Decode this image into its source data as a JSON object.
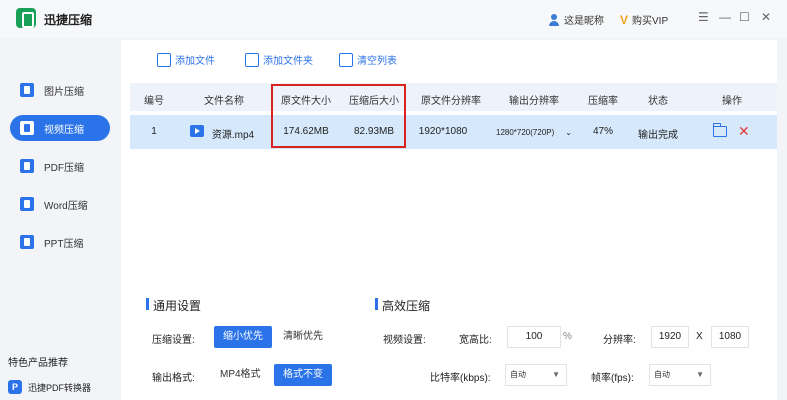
{
  "app": {
    "title": "迅捷压缩"
  },
  "account": {
    "user": "这是昵称",
    "vip": "购买VIP"
  },
  "window_controls": {
    "menu": "☰",
    "minimize": "—",
    "maximize": "☐",
    "close": "✕"
  },
  "sidebar": {
    "items": [
      {
        "label": "图片压缩",
        "icon": "image-icon"
      },
      {
        "label": "视频压缩",
        "icon": "video-icon",
        "active": true
      },
      {
        "label": "PDF压缩",
        "icon": "pdf-icon"
      },
      {
        "label": "Word压缩",
        "icon": "word-icon"
      },
      {
        "label": "PPT压缩",
        "icon": "ppt-icon"
      }
    ],
    "featured_title": "特色产品推荐",
    "featured_item": "迅捷PDF转换器",
    "featured_icon_text": "P"
  },
  "toolbar": {
    "add_file": "添加文件",
    "add_folder": "添加文件夹",
    "clear_list": "清空列表"
  },
  "table": {
    "headers": [
      "编号",
      "文件名称",
      "原文件大小",
      "压缩后大小",
      "原文件分辨率",
      "输出分辨率",
      "压缩率",
      "状态",
      "操作"
    ],
    "rows": [
      {
        "index": "1",
        "name": "资源.mp4",
        "original_size": "174.62MB",
        "compressed_size": "82.93MB",
        "original_resolution": "1920*1080",
        "output_resolution": "1280*720(720P)",
        "ratio": "47%",
        "status": "输出完成"
      }
    ]
  },
  "general": {
    "title": "通用设置",
    "compress_label": "压缩设置:",
    "opt_small": "缩小优先",
    "opt_clear": "清晰优先",
    "format_label": "输出格式:",
    "fmt_mp4": "MP4格式",
    "fmt_keep": "格式不变"
  },
  "efficient": {
    "title": "高效压缩",
    "video_label": "视频设置:",
    "ratio_label": "宽高比:",
    "ratio_value": "100",
    "ratio_unit": "%",
    "res_label": "分辨率:",
    "res_w": "1920",
    "res_x": "X",
    "res_h": "1080",
    "bitrate_label": "比特率(kbps):",
    "bitrate_value": "自动",
    "fps_label": "帧率(fps):",
    "fps_value": "自动"
  },
  "colors": {
    "accent": "#2a73e8",
    "highlight": "#d8231f",
    "row_selected": "#d6e8fb"
  }
}
